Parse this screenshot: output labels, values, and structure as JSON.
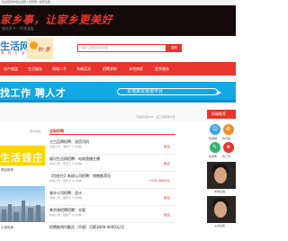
{
  "topbar": {
    "text": "欢迎来到本地生活网 | 请登录 | 免费注册"
  },
  "banner": {
    "slogan": "家乡事，让家乡更美好",
    "sub": "服务家乡 · 传递温暖"
  },
  "header": {
    "logo": "生活网",
    "logo_sub": "美 好 生 活",
    "badge_text": "秋·意",
    "search_placeholder": "请输入您要搜索的内容",
    "search_button": "搜索"
  },
  "nav": [
    "房产楼盘",
    "生活服务",
    "同城二手",
    "车辆买卖",
    "招聘求职",
    "本地商家",
    "更多服务"
  ],
  "jobad": {
    "headline": "找工作  聘人才",
    "pill": "本地真实靠谱平台"
  },
  "bar2": {
    "hint": "下载我们的APP，招工求职更方便"
  },
  "left": {
    "more": "更多视频",
    "ad1_text": "生活钱庄",
    "label1": "精品推荐",
    "label2": "小城风景"
  },
  "list": {
    "title": "全职招聘",
    "rows": [
      {
        "title": "立白品牌招聘：送货司机",
        "sub": "本地公司 · 更新于 1小时前",
        "price": "面议"
      },
      {
        "title": "顺河生活网招聘：电商直播主播",
        "sub": "本地公司 · 更新于 1小时前",
        "price": "面议"
      },
      {
        "title": "【包吃住】新成公司招聘：销售推荐员",
        "sub": "本地公司 · 更新于 2小时前",
        "price": "4200-6000元"
      },
      {
        "title": "顺丰公司招聘：会计",
        "sub": "本地公司 · 更新于 3小时前",
        "price": "面议"
      },
      {
        "title": "希京香招聘招聘：仓管",
        "sub": "本地公司 · 更新于 3小时前",
        "price": "面议"
      },
      {
        "title": "招聘推销内勤员（不限）月薪3000-4000元/月",
        "sub": "",
        "price": ""
      }
    ]
  },
  "right": {
    "header": "同城推荐",
    "icons": [
      {
        "label": "找保姆",
        "color": "#3aa0e8",
        "glyph": "☺"
      },
      {
        "label": "找月嫂",
        "color": "#f28c28",
        "glyph": "✿"
      },
      {
        "label": "找家教",
        "color": "#36b36a",
        "glyph": "✎"
      },
      {
        "label": "找工作",
        "color": "#e8342c",
        "glyph": "★"
      }
    ],
    "photos": [
      {
        "label": "本地红娘"
      },
      {
        "label": "交友征婚"
      }
    ]
  }
}
